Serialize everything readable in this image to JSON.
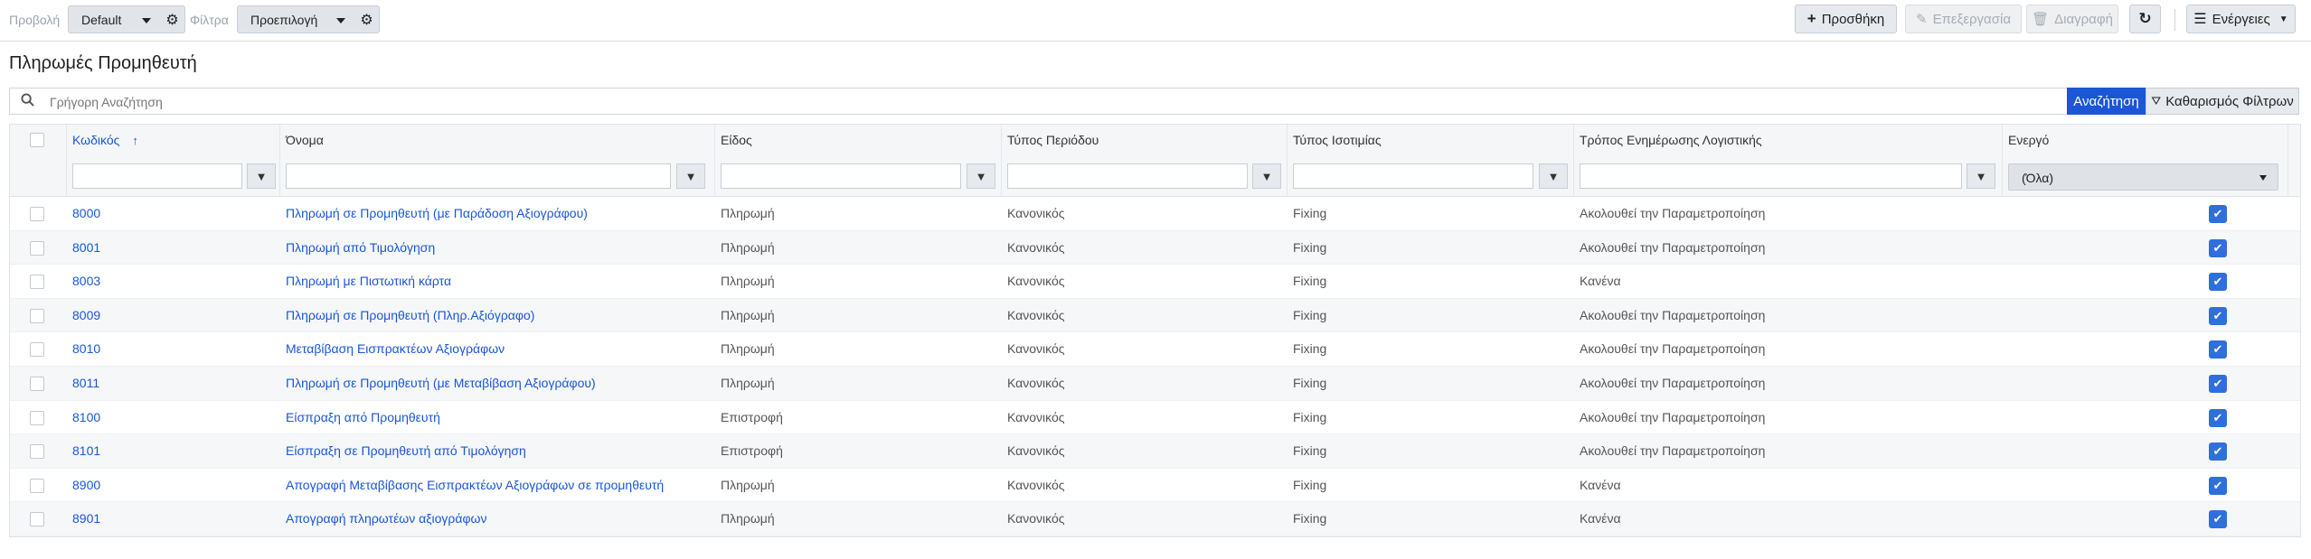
{
  "toolbar": {
    "view_label": "Προβολή",
    "view_value": "Default",
    "filter_label": "Φίλτρα",
    "filter_value": "Προεπιλογή",
    "add_label": "Προσθήκη",
    "edit_label": "Επεξεργασία",
    "delete_label": "Διαγραφή",
    "actions_label": "Ενέργειες"
  },
  "page": {
    "title": "Πληρωμές Προμηθευτή"
  },
  "search": {
    "placeholder": "Γρήγορη Αναζήτηση",
    "search_label": "Αναζήτηση",
    "clear_label": "Καθαρισμός Φίλτρων"
  },
  "table": {
    "columns": [
      "Κωδικός",
      "Όνομα",
      "Είδος",
      "Τύπος Περιόδου",
      "Τύπος Ισοτιμίας",
      "Τρόπος Ενημέρωσης Λογιστικής",
      "Ενεργό"
    ],
    "active_filter_value": "(Όλα)",
    "rows": [
      {
        "code": "8000",
        "name": "Πληρωμή σε Προμηθευτή (με Παράδοση Αξιογράφου)",
        "kind": "Πληρωμή",
        "period": "Κανονικός",
        "rate": "Fixing",
        "accounting": "Ακολουθεί την Παραμετροποίηση",
        "active": true
      },
      {
        "code": "8001",
        "name": "Πληρωμή από Τιμολόγηση",
        "kind": "Πληρωμή",
        "period": "Κανονικός",
        "rate": "Fixing",
        "accounting": "Ακολουθεί την Παραμετροποίηση",
        "active": true
      },
      {
        "code": "8003",
        "name": "Πληρωμή με Πιστωτική κάρτα",
        "kind": "Πληρωμή",
        "period": "Κανονικός",
        "rate": "Fixing",
        "accounting": "Κανένα",
        "active": true
      },
      {
        "code": "8009",
        "name": "Πληρωμή σε Προμηθευτή (Πληρ.Αξιόγραφο)",
        "kind": "Πληρωμή",
        "period": "Κανονικός",
        "rate": "Fixing",
        "accounting": "Ακολουθεί την Παραμετροποίηση",
        "active": true
      },
      {
        "code": "8010",
        "name": "Μεταβίβαση Εισπρακτέων Αξιογράφων",
        "kind": "Πληρωμή",
        "period": "Κανονικός",
        "rate": "Fixing",
        "accounting": "Ακολουθεί την Παραμετροποίηση",
        "active": true
      },
      {
        "code": "8011",
        "name": "Πληρωμή σε Προμηθευτή (με Μεταβίβαση Αξιογράφου)",
        "kind": "Πληρωμή",
        "period": "Κανονικός",
        "rate": "Fixing",
        "accounting": "Ακολουθεί την Παραμετροποίηση",
        "active": true
      },
      {
        "code": "8100",
        "name": "Είσπραξη από Προμηθευτή",
        "kind": "Επιστροφή",
        "period": "Κανονικός",
        "rate": "Fixing",
        "accounting": "Ακολουθεί την Παραμετροποίηση",
        "active": true
      },
      {
        "code": "8101",
        "name": "Είσπραξη σε Προμηθευτή από Τιμολόγηση",
        "kind": "Επιστροφή",
        "period": "Κανονικός",
        "rate": "Fixing",
        "accounting": "Ακολουθεί την Παραμετροποίηση",
        "active": true
      },
      {
        "code": "8900",
        "name": "Απογραφή Μεταβίβασης Εισπρακτέων Αξιογράφων σε προμηθευτή",
        "kind": "Πληρωμή",
        "period": "Κανονικός",
        "rate": "Fixing",
        "accounting": "Κανένα",
        "active": true
      },
      {
        "code": "8901",
        "name": "Απογραφή πληρωτέων αξιογράφων",
        "kind": "Πληρωμή",
        "period": "Κανονικός",
        "rate": "Fixing",
        "accounting": "Κανένα",
        "active": true
      }
    ]
  },
  "colors": {
    "accent": "#1a56d6",
    "checkbox": "#2f6fdc"
  }
}
